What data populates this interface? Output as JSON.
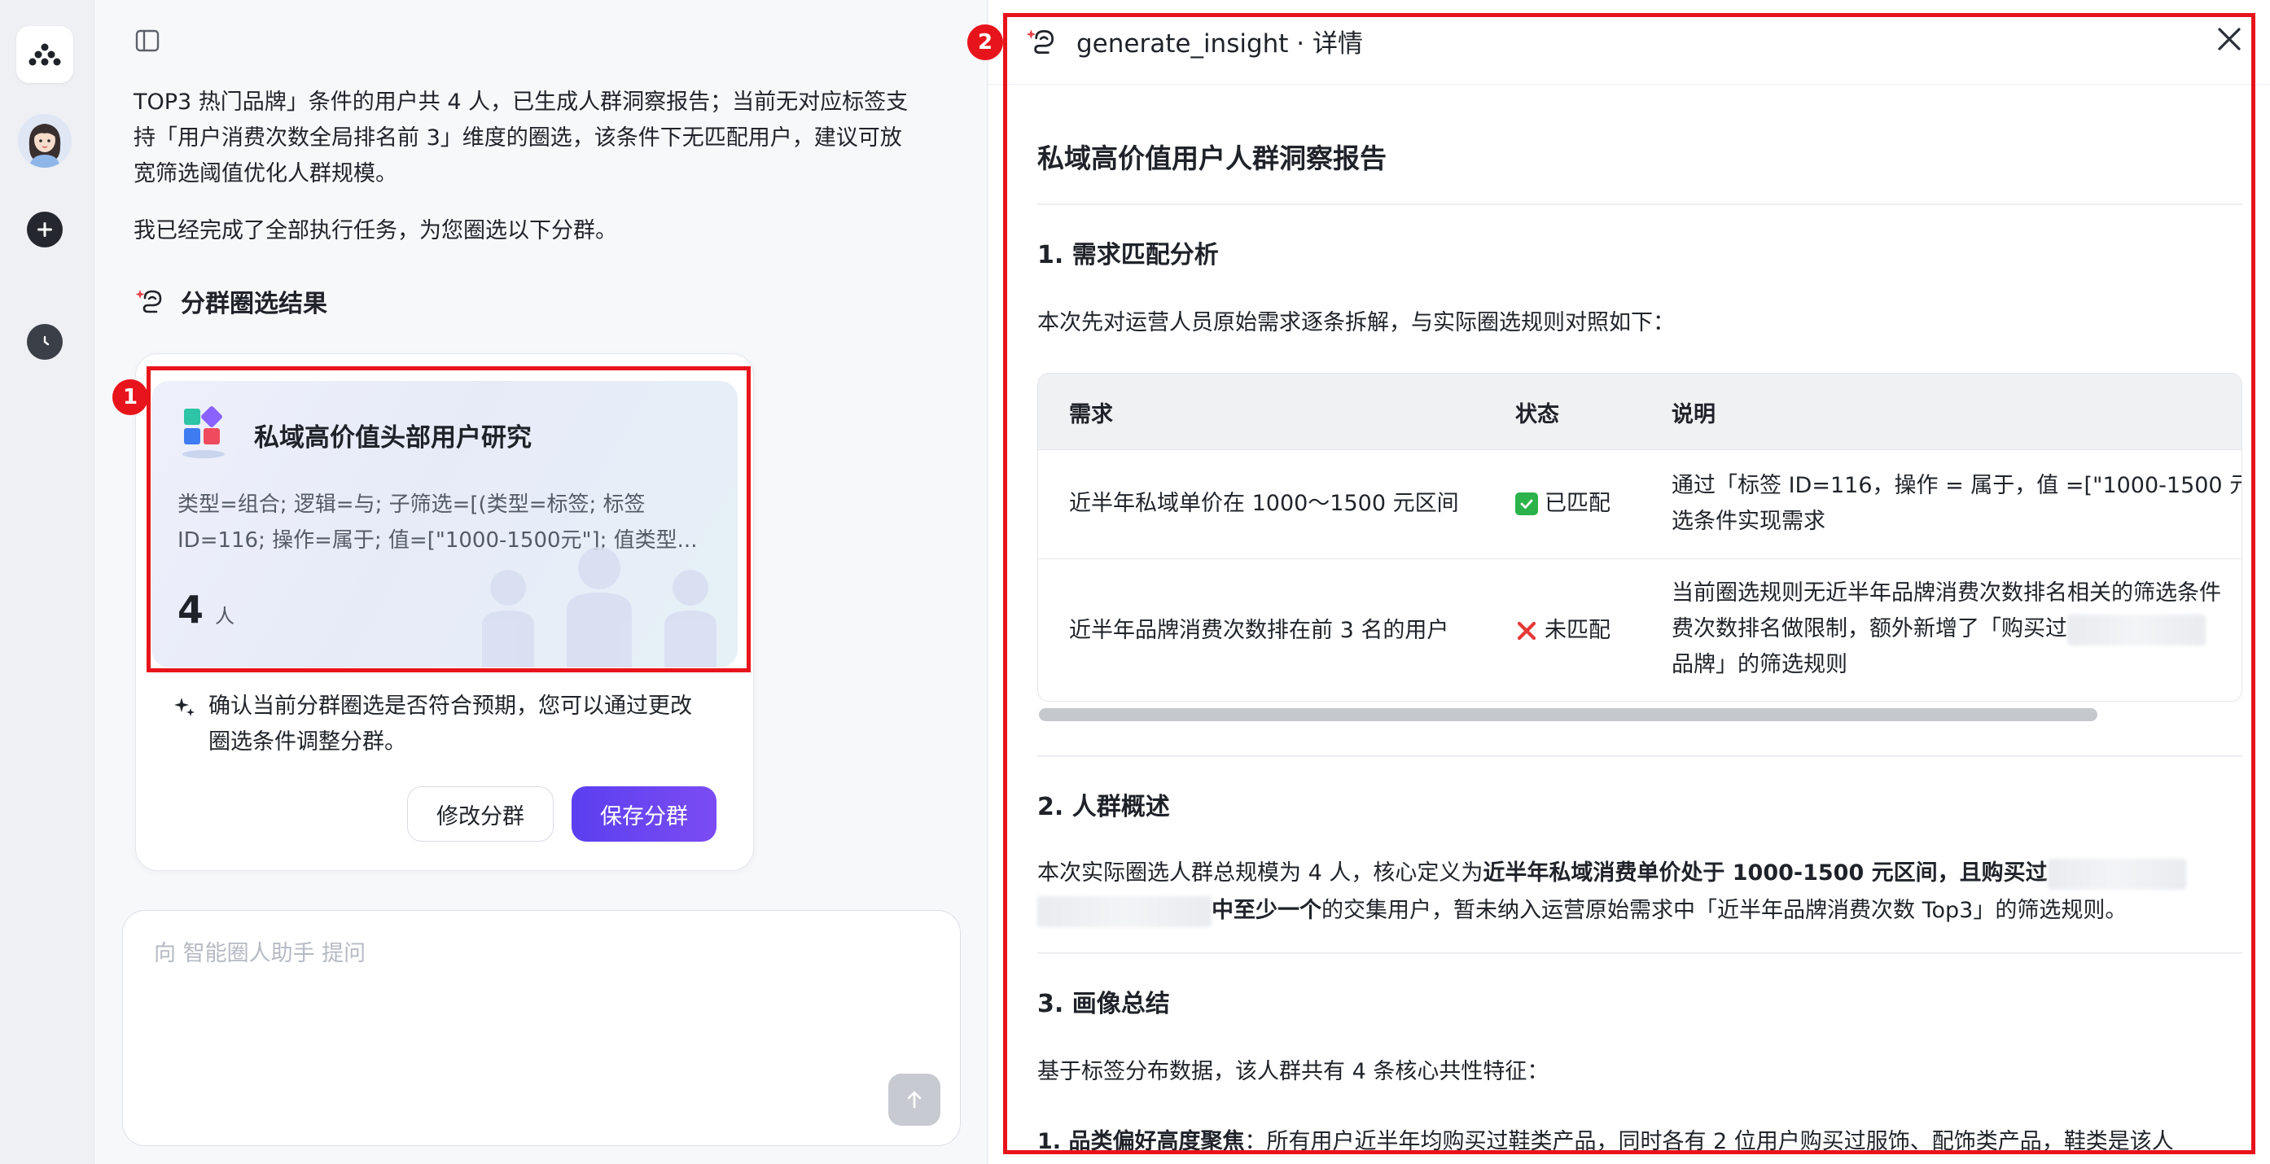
{
  "chat": {
    "message_line1": "TOP3 热门品牌」条件的用户共 4 人，已生成人群洞察报告；当前无对应标签支",
    "message_line2": "持「用户消费次数全局排名前 3」维度的圈选，该条件下无匹配用户，建议可放",
    "message_line3": "宽筛选阈值优化人群规模。",
    "message_done": "我已经完成了全部执行任务，为您圈选以下分群。",
    "section_title": "分群圈选结果",
    "segment": {
      "title": "私域高价值头部用户研究",
      "desc_line1": "类型=组合; 逻辑=与; 子筛选=[(类型=标签; 标签",
      "desc_line2": "ID=116; 操作=属于; 值=[\"1000-1500元\"]; 值类型...",
      "count": "4",
      "unit": "人"
    },
    "confirm_line1": "确认当前分群圈选是否符合预期，您可以通过更改",
    "confirm_line2": "圈选条件调整分群。",
    "modify_label": "修改分群",
    "save_label": "保存分群",
    "input_placeholder": "向 智能圈人助手 提问"
  },
  "annotations": {
    "one": "1",
    "two": "2"
  },
  "detail": {
    "title": "generate_insight · 详情",
    "report_title": "私域高价值用户人群洞察报告",
    "s1_title": "1. 需求匹配分析",
    "s1_intro": "本次先对运营人员原始需求逐条拆解，与实际圈选规则对照如下：",
    "table": {
      "headers": [
        "需求",
        "状态",
        "说明"
      ],
      "rows": [
        {
          "need": "近半年私域单价在 1000～1500 元区间",
          "status": "已匹配",
          "note_line1": "通过「标签 ID=116，操作 = 属于，值 =[\"1000-1500 元",
          "note_line2": "选条件实现需求"
        },
        {
          "need": "近半年品牌消费次数排在前 3 名的用户",
          "status": "未匹配",
          "note_line1": "当前圈选规则无近半年品牌消费次数排名相关的筛选条件",
          "note_line2": "费次数排名做限制，额外新增了「购买过",
          "note_line3": "品牌」的筛选规则"
        }
      ]
    },
    "s2_title": "2. 人群概述",
    "s2_p1_a": "本次实际圈选人群总规模为 4 人，核心定义为",
    "s2_p1_b": "近半年私域消费单价处于 1000-1500 元区间，且购买过",
    "s2_p2_b": "中至少一个",
    "s2_p2_c": "的交集用户，暂未纳入运营原始需求中「近半年品牌消费次数 Top3」的筛选规则。",
    "s3_title": "3. 画像总结",
    "s3_intro": "基于标签分布数据，该人群共有 4 条核心共性特征：",
    "s3_item1_b": "1. 品类偏好高度聚焦",
    "s3_item1_c": "：所有用户近半年均购买过鞋类产品，同时各有 2 位用户购买过服饰、配饰类产品，鞋类是该人"
  },
  "colors": {
    "annotation_red": "#e8141b",
    "primary_purple": "#5b3ff0",
    "matched_green": "#2cb24a",
    "unmatched_red": "#e53935"
  }
}
